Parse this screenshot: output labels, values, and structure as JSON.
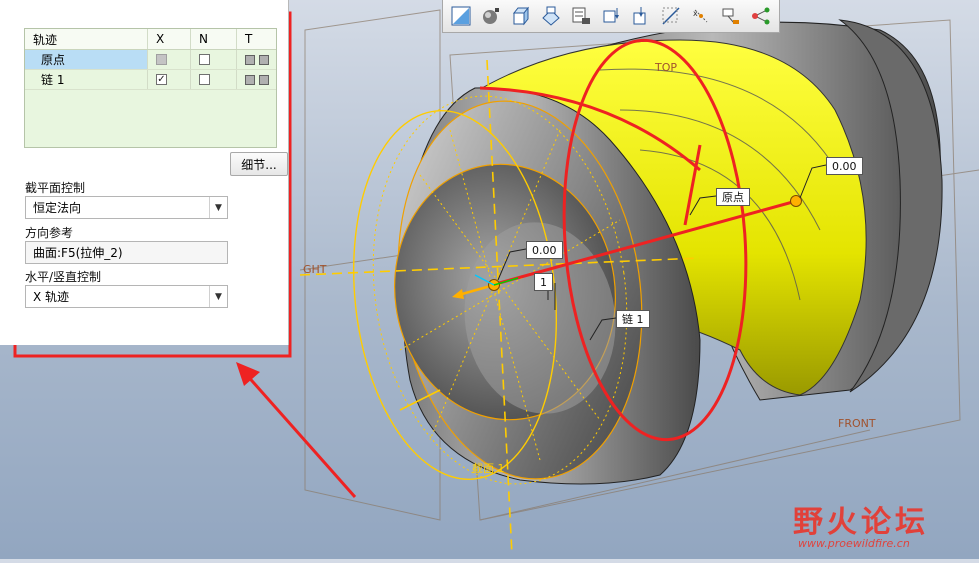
{
  "panel": {
    "table": {
      "headers": [
        "轨迹",
        "X",
        "N",
        "T"
      ],
      "rows": [
        {
          "name": "原点",
          "x_checked": false,
          "x_disabled": true,
          "n_checked": false
        },
        {
          "name": "链 1",
          "x_checked": true,
          "x_disabled": false,
          "n_checked": false
        }
      ]
    },
    "details_label": "细节...",
    "section_control_label": "截平面控制",
    "section_control_value": "恒定法向",
    "direction_ref_label": "方向参考",
    "direction_ref_value": "曲面:F5(拉伸_2)",
    "hv_control_label": "水平/竖直控制",
    "hv_control_value": "X 轨迹"
  },
  "toolbar": {
    "icons": [
      "display-style-icon",
      "shading-icon",
      "view-box-icon",
      "saved-views-icon",
      "view-manager-icon",
      "plane-display-icon",
      "axis-display-icon",
      "point-display-icon",
      "csys-display-icon",
      "annotation-display-icon",
      "spin-center-icon"
    ]
  },
  "viewport": {
    "plane_labels": {
      "top": "TOP",
      "front": "FRONT",
      "left": "GHT"
    },
    "dimension_a": "0.00",
    "dimension_b": "0.00",
    "origin_tag": "原点",
    "chain_tag": "链 1",
    "section_tag": "截面 1",
    "small_tag": "1"
  },
  "watermark": {
    "text": "野火论坛",
    "url": "www.proewildfire.cn"
  },
  "colors": {
    "highlight_red": "#e8392f",
    "surface_yellow": "#e6e600",
    "section_orange": "#ffb000"
  }
}
